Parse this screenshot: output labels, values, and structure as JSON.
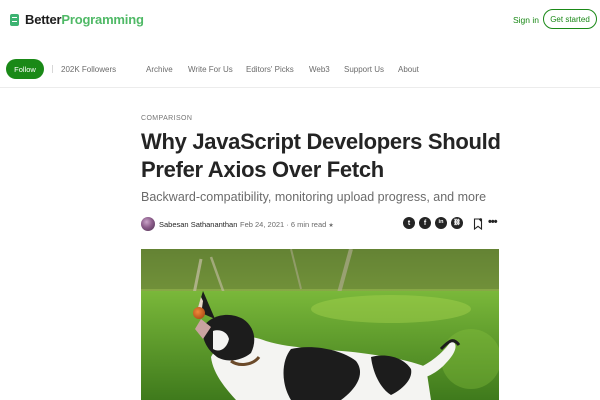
{
  "header": {
    "logo_part1": "Better",
    "logo_part2": "Programming",
    "sign_in_label": "Sign in",
    "get_started_label": "Get started",
    "brand_color": "#1a8917"
  },
  "pub_nav": {
    "follow_label": "Follow",
    "followers": "202K Followers",
    "items": [
      "Archive",
      "Write For Us",
      "Editors' Picks",
      "Web3",
      "Support Us",
      "About"
    ]
  },
  "article": {
    "kicker": "COMPARISON",
    "title": "Why JavaScript Developers Should Prefer Axios Over Fetch",
    "subtitle": "Backward-compatibility, monitoring upload progress, and more",
    "author": "Sabesan Sathananthan",
    "date": "Feb 24, 2021",
    "read_time": "6 min read",
    "star": "★",
    "share_icons": [
      "twitter-icon",
      "facebook-icon",
      "linkedin-icon",
      "link-icon"
    ],
    "share_glyphs": [
      "t",
      "f",
      "in",
      "⛓"
    ],
    "hero_image": "dog-catching-ball-icon"
  }
}
